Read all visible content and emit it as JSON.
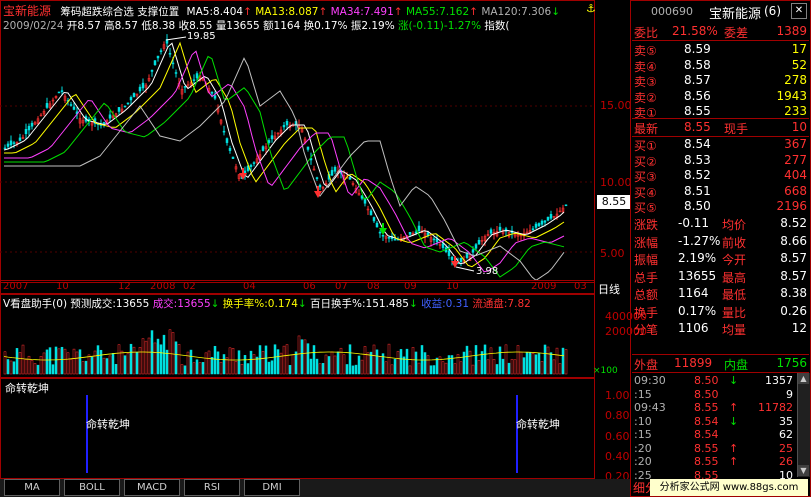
{
  "chart_header": {
    "stock_name": "宝新能源",
    "indicator_name": "筹码超跌综合选 支撑位置",
    "ma5": "MA5:8.404",
    "ma13": "MA13:8.087",
    "ma34": "MA34:7.491",
    "ma55": "MA55:7.162",
    "ma120": "MA120:7.306",
    "ma_arrow_up": "↑",
    "ma_arrow_down": "↓"
  },
  "info_line": {
    "date": "2009/02/24",
    "open": "开8.57",
    "high": "高8.57",
    "low": "低8.38",
    "close": "收8.55",
    "volume": "量13655",
    "amount": "额1164",
    "turnover": "换0.17%",
    "amplitude": "振2.19%",
    "change": "涨(-0.11)-1.27%",
    "index_label": "指数("
  },
  "price_axis": [
    "15.00",
    "10.00",
    "5.00"
  ],
  "price_annotations": {
    "high_label": "19.85",
    "low_label": "3.98",
    "current_price": "8.55"
  },
  "time_axis": [
    "2007",
    "10",
    "12",
    "2008",
    "02",
    "04",
    "06",
    "07",
    "08",
    "09",
    "10",
    "2009",
    "03"
  ],
  "period_label": "日线",
  "volume_header": {
    "title": "V看盘助手(0) 预测成交:13655",
    "chengjiao": "成交:13655",
    "huanshoulv": "换手率%:0.174",
    "bairi": "百日换手%:151.485",
    "shouyi": "收益:0.31",
    "liutong": "流通盘:7.82"
  },
  "volume_axis": [
    "400000",
    "200000"
  ],
  "volume_unit": "×100",
  "indicator_panel": {
    "title": "命转乾坤",
    "signal_labels": [
      "命转乾坤",
      "命转乾坤"
    ],
    "axis": [
      "1.00",
      "0.80",
      "0.60",
      "0.40",
      "0.20"
    ]
  },
  "tabs": [
    "MA",
    "BOLL",
    "MACD",
    "RSI",
    "DMI"
  ],
  "right_panel": {
    "code": "000690",
    "name": "宝新能源",
    "suffix": "(6)",
    "weibi_label": "委比",
    "weibi_value": "21.58%",
    "weicha_label": "委差",
    "weicha_value": "1389",
    "sell": [
      {
        "label": "卖⑤",
        "price": "8.59",
        "vol": "17"
      },
      {
        "label": "卖④",
        "price": "8.58",
        "vol": "52"
      },
      {
        "label": "卖③",
        "price": "8.57",
        "vol": "278"
      },
      {
        "label": "卖②",
        "price": "8.56",
        "vol": "1943"
      },
      {
        "label": "卖①",
        "price": "8.55",
        "vol": "233"
      }
    ],
    "latest": {
      "label": "最新",
      "price": "8.55",
      "sub_label": "现手",
      "sub_value": "10"
    },
    "buy": [
      {
        "label": "买①",
        "price": "8.54",
        "vol": "367"
      },
      {
        "label": "买②",
        "price": "8.53",
        "vol": "277"
      },
      {
        "label": "买③",
        "price": "8.52",
        "vol": "404"
      },
      {
        "label": "买④",
        "price": "8.51",
        "vol": "668"
      },
      {
        "label": "买⑤",
        "price": "8.50",
        "vol": "2196"
      }
    ],
    "stats": [
      {
        "l1": "涨跌",
        "v1": "-0.11",
        "l2": "均价",
        "v2": "8.52"
      },
      {
        "l1": "涨幅",
        "v1": "-1.27%",
        "l2": "前收",
        "v2": "8.66"
      },
      {
        "l1": "振幅",
        "v1": "2.19%",
        "l2": "今开",
        "v2": "8.57"
      },
      {
        "l1": "总手",
        "v1": "13655",
        "l2": "最高",
        "v2": "8.57"
      },
      {
        "l1": "总额",
        "v1": "1164",
        "l2": "最低",
        "v2": "8.38"
      },
      {
        "l1": "换手",
        "v1": "0.17%",
        "l2": "量比",
        "v2": "0.26"
      },
      {
        "l1": "分笔",
        "v1": "1106",
        "l2": "均量",
        "v2": "12"
      }
    ],
    "waipan_label": "外盘",
    "waipan_value": "11899",
    "neipan_label": "内盘",
    "neipan_value": "1756",
    "ticks": [
      {
        "time": "09:30",
        "price": "8.50",
        "dir": "↓",
        "vol": "1357"
      },
      {
        "time": ":15",
        "price": "8.50",
        "dir": "",
        "vol": "9"
      },
      {
        "time": "09:43",
        "price": "8.55",
        "dir": "↑",
        "vol": "11782"
      },
      {
        "time": ":10",
        "price": "8.54",
        "dir": "↓",
        "vol": "35"
      },
      {
        "time": ":15",
        "price": "8.54",
        "dir": "",
        "vol": "62"
      },
      {
        "time": ":20",
        "price": "8.55",
        "dir": "↑",
        "vol": "25"
      },
      {
        "time": ":20",
        "price": "8.55",
        "dir": "↑",
        "vol": "26"
      },
      {
        "time": ":25",
        "price": "8.55",
        "dir": "",
        "vol": "10"
      }
    ],
    "bottom_label": "细分",
    "watermark": "分析家公式网 www.88gs.com"
  },
  "colors": {
    "up": "#ff3030",
    "down": "#00e000",
    "border": "#a00000",
    "ma5": "#ffffff",
    "ma13": "#ffff00",
    "ma34": "#ff40ff",
    "ma55": "#00e000",
    "ma120": "#c0c0c0"
  }
}
